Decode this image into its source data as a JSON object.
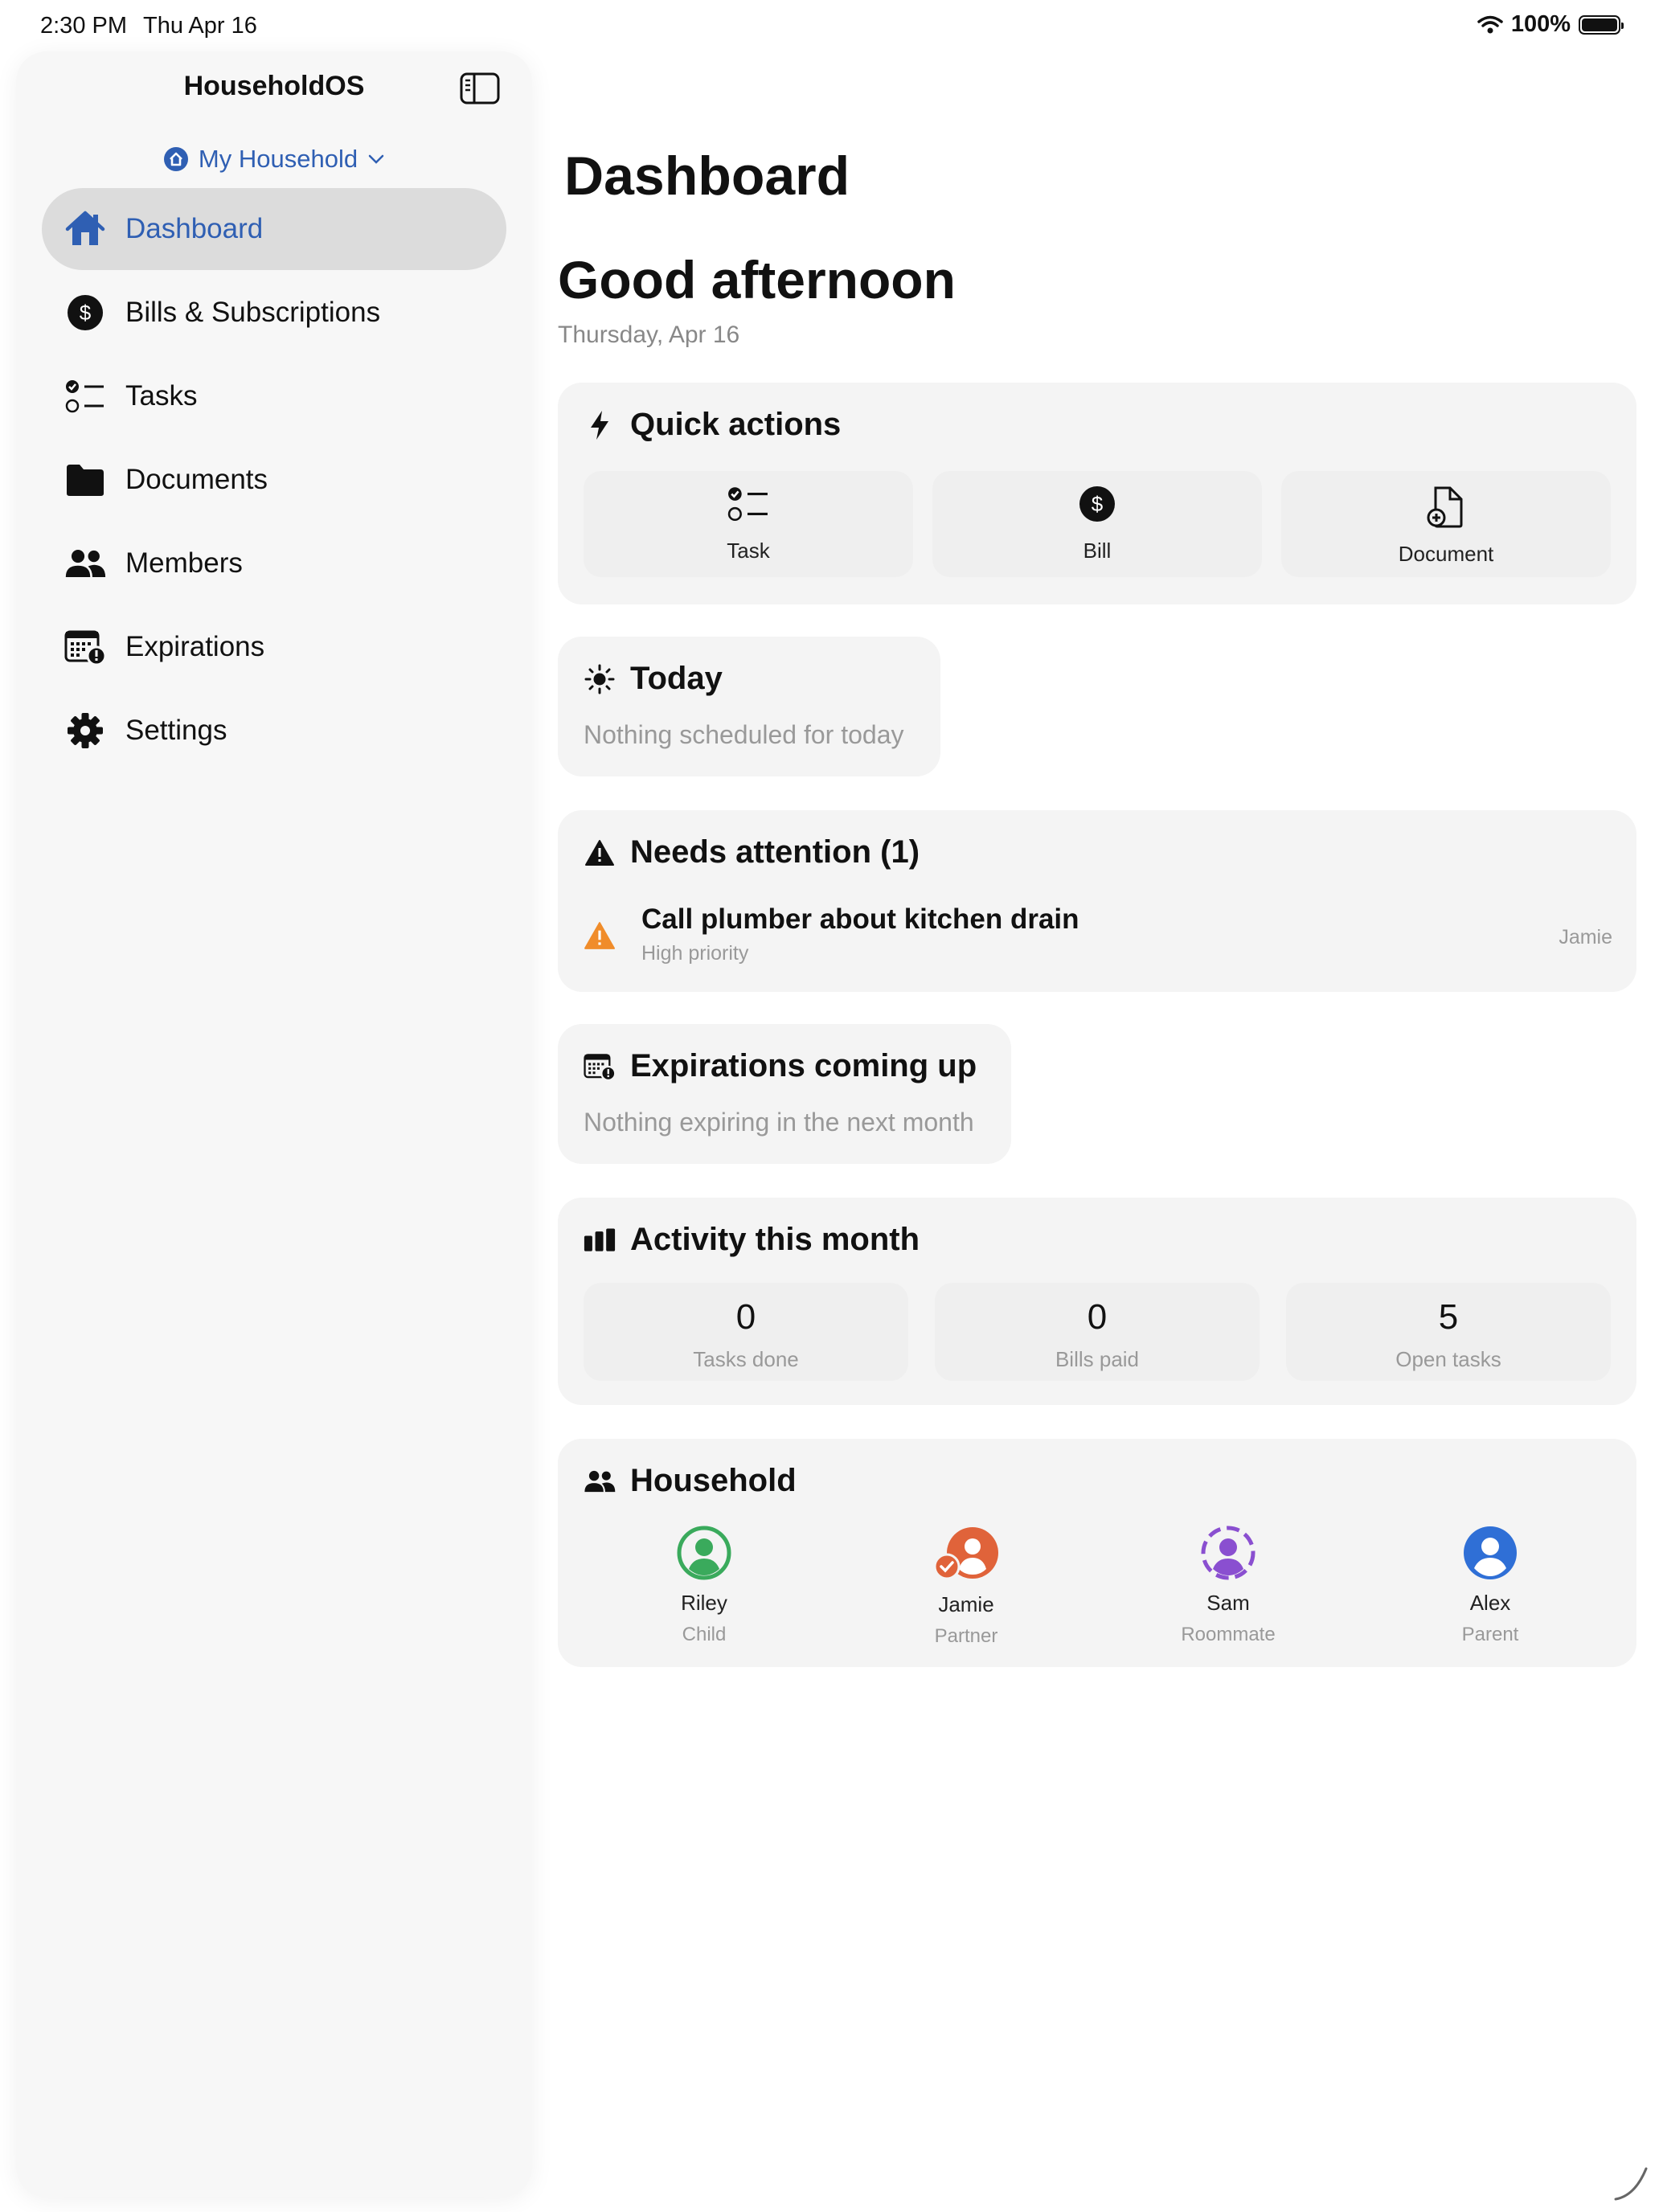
{
  "status_bar": {
    "time": "2:30 PM",
    "date": "Thu Apr 16",
    "battery": "100%"
  },
  "sidebar": {
    "app_title": "HouseholdOS",
    "household_selector": "My Household",
    "items": [
      {
        "label": "Dashboard",
        "icon": "house-icon",
        "active": true
      },
      {
        "label": "Bills & Subscriptions",
        "icon": "dollar-circle-icon"
      },
      {
        "label": "Tasks",
        "icon": "checklist-icon"
      },
      {
        "label": "Documents",
        "icon": "folder-icon"
      },
      {
        "label": "Members",
        "icon": "people-icon"
      },
      {
        "label": "Expirations",
        "icon": "calendar-alert-icon"
      },
      {
        "label": "Settings",
        "icon": "gear-icon"
      }
    ]
  },
  "main": {
    "page_title": "Dashboard",
    "greeting": "Good afternoon",
    "date": "Thursday, Apr 16",
    "quick_actions": {
      "title": "Quick actions",
      "actions": [
        {
          "label": "Task",
          "icon": "checklist-icon"
        },
        {
          "label": "Bill",
          "icon": "dollar-circle-icon"
        },
        {
          "label": "Document",
          "icon": "doc-plus-icon"
        }
      ]
    },
    "today": {
      "title": "Today",
      "empty": "Nothing scheduled for today"
    },
    "attention": {
      "title": "Needs attention (1)",
      "items": [
        {
          "title": "Call plumber about kitchen drain",
          "subtitle": "High priority",
          "assignee": "Jamie"
        }
      ]
    },
    "expirations": {
      "title": "Expirations coming up",
      "empty": "Nothing expiring in the next month"
    },
    "activity": {
      "title": "Activity this month",
      "stats": [
        {
          "value": "0",
          "label": "Tasks done"
        },
        {
          "value": "0",
          "label": "Bills paid"
        },
        {
          "value": "5",
          "label": "Open tasks"
        }
      ]
    },
    "household": {
      "title": "Household",
      "members": [
        {
          "name": "Riley",
          "role": "Child",
          "color": "#3aaa5c"
        },
        {
          "name": "Jamie",
          "role": "Partner",
          "color": "#e0633a"
        },
        {
          "name": "Sam",
          "role": "Roommate",
          "color": "#8a4fd0"
        },
        {
          "name": "Alex",
          "role": "Parent",
          "color": "#2f6fd6"
        }
      ]
    }
  },
  "colors": {
    "accent": "#2f5fb3",
    "warning": "#f08c2a"
  }
}
